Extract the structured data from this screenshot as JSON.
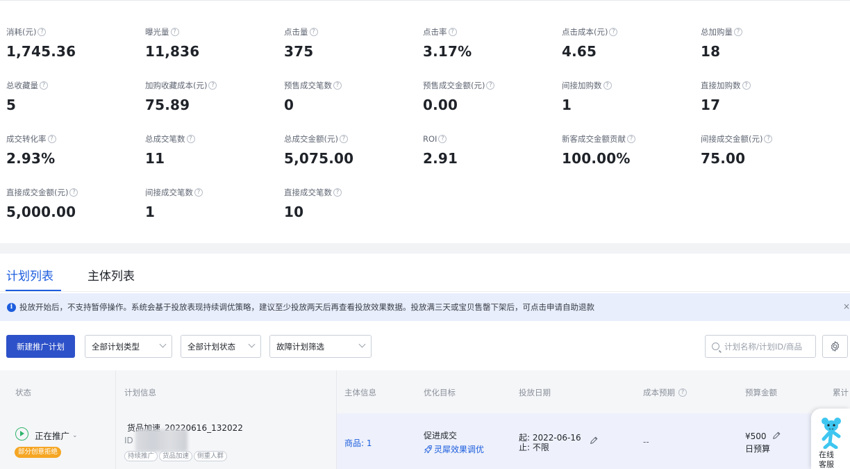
{
  "metrics": [
    {
      "label": "消耗(元)",
      "value": "1,745.36"
    },
    {
      "label": "曝光量",
      "value": "11,836"
    },
    {
      "label": "点击量",
      "value": "375"
    },
    {
      "label": "点击率",
      "value": "3.17%"
    },
    {
      "label": "点击成本(元)",
      "value": "4.65"
    },
    {
      "label": "总加购量",
      "value": "18"
    },
    {
      "label": "总收藏量",
      "value": "5"
    },
    {
      "label": "加购收藏成本(元)",
      "value": "75.89"
    },
    {
      "label": "预售成交笔数",
      "value": "0"
    },
    {
      "label": "预售成交金额(元)",
      "value": "0.00"
    },
    {
      "label": "间接加购数",
      "value": "1"
    },
    {
      "label": "直接加购数",
      "value": "17"
    },
    {
      "label": "成交转化率",
      "value": "2.93%"
    },
    {
      "label": "总成交笔数",
      "value": "11"
    },
    {
      "label": "总成交金额(元)",
      "value": "5,075.00"
    },
    {
      "label": "ROI",
      "value": "2.91"
    },
    {
      "label": "新客成交金额贡献",
      "value": "100.00%"
    },
    {
      "label": "间接成交金额(元)",
      "value": "75.00"
    },
    {
      "label": "直接成交金额(元)",
      "value": "5,000.00"
    },
    {
      "label": "间接成交笔数",
      "value": "1"
    },
    {
      "label": "直接成交笔数",
      "value": "10"
    }
  ],
  "help_glyph": "?",
  "tabs": [
    {
      "label": "计划列表",
      "active": true
    },
    {
      "label": "主体列表",
      "active": false
    }
  ],
  "notice": {
    "icon": "i",
    "text": "投放开始后，不支持暂停操作。系统会基于投放表现持续调优策略，建议至少投放两天后再查看投放效果数据。投放满三天或宝贝售罄下架后，可点击申请自助退款",
    "close": "×"
  },
  "toolbar": {
    "new_plan": "新建推广计划",
    "filter_type": "全部计划类型",
    "filter_status": "全部计划状态",
    "filter_fault": "故障计划筛选",
    "search_placeholder": "计划名称/计划ID/商品"
  },
  "table": {
    "headers": {
      "status": "状态",
      "plan_info": "计划信息",
      "subject": "主体信息",
      "goal": "优化目标",
      "dates": "投放日期",
      "cost_estimate": "成本预期",
      "budget": "预算金额",
      "cumulative": "累计"
    },
    "rows": [
      {
        "status": "正在推广",
        "status_caret": "⌄",
        "badge": "部分创意拒绝",
        "plan_name": "货品加速_20220616_132022",
        "id_prefix": "ID",
        "tags": [
          "持续推广",
          "货品加速",
          "侧重人群"
        ],
        "subject": "商品: 1",
        "goal": "促进成交",
        "goal_link": "灵犀效果调优",
        "start": "起: 2022-06-16",
        "end": "止: 不限",
        "cost": "--",
        "budget": "¥500",
        "budget_type": "日预算"
      }
    ]
  },
  "support": {
    "line1": "在线",
    "line2": "客服"
  },
  "colors": {
    "accent": "#1c5dde",
    "primary_button": "#2d51c8",
    "running_green": "#2fb46b",
    "warning_badge": "#f5a623"
  }
}
